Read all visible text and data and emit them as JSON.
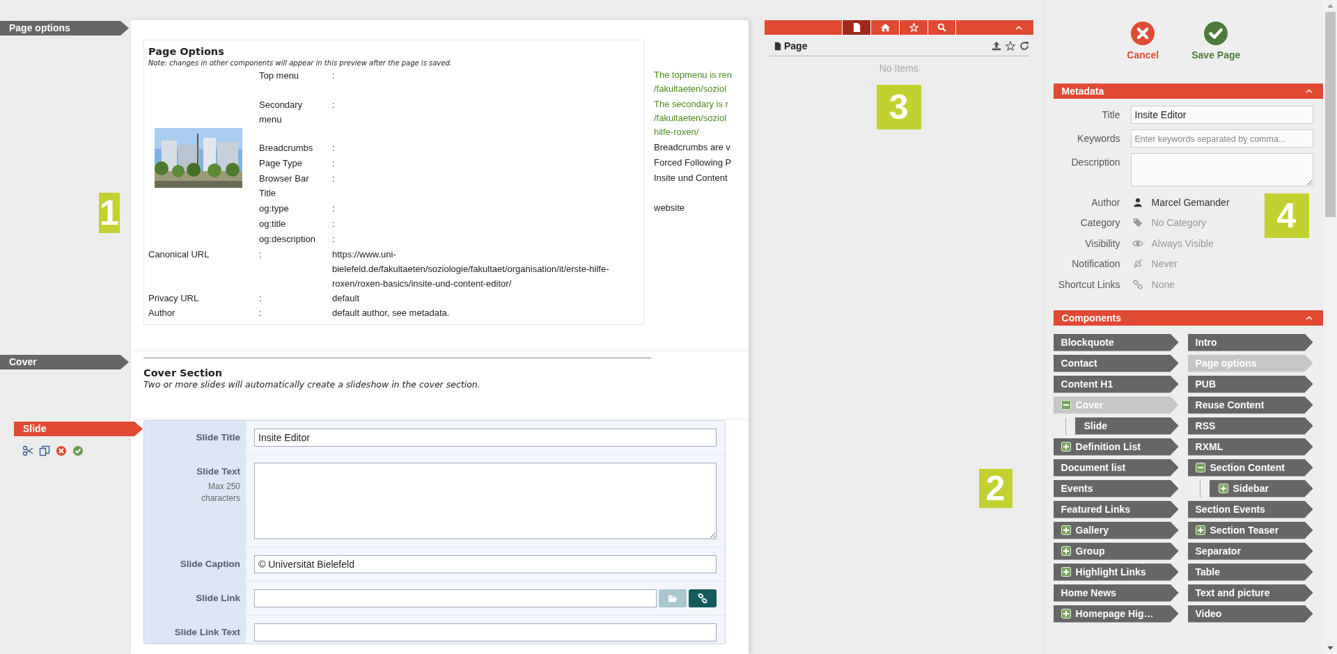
{
  "page_options": {
    "tag": "Page options",
    "callout": "1",
    "heading": "Page Options",
    "note": "Note: changes in other components will appear in this preview after the page is saved.",
    "image_rows": [
      {
        "label": "Top menu",
        "sep": ":",
        "value": [
          "The topmenu is ren",
          "/fakultaeten/soziol"
        ],
        "color": "#4a8a1c"
      },
      {
        "label": "Secondary menu",
        "sep": ":",
        "value": [
          "The secondary is r",
          "/fakultaeten/soziol",
          "hilfe-roxen/"
        ],
        "color": "#4a8a1c"
      },
      {
        "label": "Breadcrumbs",
        "sep": ":",
        "value": [
          "Breadcrumbs are v"
        ],
        "color": "#222222"
      },
      {
        "label": "Page Type",
        "sep": ":",
        "value": [
          "Forced Following P"
        ],
        "color": "#222222"
      },
      {
        "label": "Browser Bar Title",
        "sep": ":",
        "value": [
          "Insite und Content"
        ],
        "color": "#222222"
      },
      {
        "label": "og:type",
        "sep": ":",
        "value": [
          "website"
        ],
        "color": "#222222"
      },
      {
        "label": "og:title",
        "sep": ":",
        "value": []
      },
      {
        "label": "og:description",
        "sep": ":",
        "value": []
      }
    ],
    "rows": [
      {
        "label": "Canonical URL",
        "sep": ":",
        "value": "https://www.uni-bielefeld.de/fakultaeten/soziologie/fakultaet/organisation/it/erste-hilfe-roxen/roxen-basics/insite-und-content-editor/"
      },
      {
        "label": "Privacy URL",
        "sep": ":",
        "value": "default"
      },
      {
        "label": "Author",
        "sep": ":",
        "value": "default author, see metadata."
      }
    ]
  },
  "cover": {
    "tag": "Cover",
    "heading": "Cover Section",
    "note": "Two or more slides will automatically create a slideshow in the cover section."
  },
  "slide": {
    "tag": "Slide",
    "tools": [
      {
        "kind": "cut"
      },
      {
        "kind": "copy"
      },
      {
        "kind": "delete"
      },
      {
        "kind": "confirm"
      }
    ],
    "fields": [
      {
        "label": "Slide Title",
        "kind": "text",
        "value": "Insite Editor"
      },
      {
        "label": "Slide Text",
        "hint": "Max 250 characters",
        "kind": "textarea"
      },
      {
        "label": "Slide Caption",
        "kind": "text",
        "value": "© Universität Bielefeld"
      },
      {
        "label": "Slide Link",
        "kind": "link"
      },
      {
        "label": "Slide Link Text",
        "kind": "text"
      }
    ]
  },
  "browser": {
    "tabs": [
      {
        "kind": "page",
        "selected": true
      },
      {
        "kind": "home",
        "selected": false
      },
      {
        "kind": "favorites",
        "selected": false
      },
      {
        "kind": "search",
        "selected": false
      }
    ],
    "title": "Page",
    "empty": "No Items",
    "callout": "3"
  },
  "actions": [
    {
      "kind": "cancel",
      "label": "Cancel"
    },
    {
      "kind": "save",
      "label": "Save Page"
    }
  ],
  "metadata": {
    "title": "Metadata",
    "callout": "4",
    "fields": [
      {
        "label": "Title",
        "kind": "input",
        "value": "Insite Editor"
      },
      {
        "label": "Keywords",
        "kind": "input",
        "placeholder": "Enter keywords separated by comma..."
      },
      {
        "label": "Description",
        "kind": "textarea"
      }
    ],
    "info": [
      {
        "label": "Author",
        "kind": "author",
        "value": "Marcel Gemander",
        "muted": false
      },
      {
        "label": "Category",
        "kind": "category",
        "value": "No Category",
        "muted": true
      },
      {
        "label": "Visibility",
        "kind": "visibility",
        "value": "Always Visible",
        "muted": true
      },
      {
        "label": "Notification",
        "kind": "notification",
        "value": "Never",
        "muted": true
      },
      {
        "label": "Shortcut Links",
        "kind": "links",
        "value": "None",
        "muted": true
      }
    ]
  },
  "components": {
    "title": "Components",
    "callout": "2",
    "columns": [
      [
        {
          "label": "Blockquote",
          "selected": false
        },
        {
          "label": "Contact",
          "selected": false
        },
        {
          "label": "Content H1",
          "selected": false
        },
        {
          "label": "Cover",
          "selected": true,
          "expanded": true,
          "children": [
            {
              "label": "Slide",
              "selected": false
            }
          ]
        },
        {
          "label": "Definition List",
          "selected": false,
          "expanded": false
        },
        {
          "label": "Document list",
          "selected": false
        },
        {
          "label": "Events",
          "selected": false
        },
        {
          "label": "Featured Links",
          "selected": false
        },
        {
          "label": "Gallery",
          "selected": false,
          "expanded": false
        },
        {
          "label": "Group",
          "selected": false,
          "expanded": false
        },
        {
          "label": "Highlight Links",
          "selected": false,
          "expanded": false
        },
        {
          "label": "Home News",
          "selected": false
        },
        {
          "label": "Homepage Hig…",
          "selected": false,
          "expanded": false
        }
      ],
      [
        {
          "label": "Intro",
          "selected": false
        },
        {
          "label": "Page options",
          "selected": true
        },
        {
          "label": "PUB",
          "selected": false
        },
        {
          "label": "Reuse Content",
          "selected": false
        },
        {
          "label": "RSS",
          "selected": false
        },
        {
          "label": "RXML",
          "selected": false
        },
        {
          "label": "Section Content",
          "selected": false,
          "expanded": true,
          "children": [
            {
              "label": "Sidebar",
              "selected": false,
              "expanded": false
            }
          ]
        },
        {
          "label": "Section Events",
          "selected": false
        },
        {
          "label": "Section Teaser",
          "selected": false,
          "expanded": false
        },
        {
          "label": "Separator",
          "selected": false
        },
        {
          "label": "Table",
          "selected": false
        },
        {
          "label": "Text and picture",
          "selected": false
        },
        {
          "label": "Video",
          "selected": false
        }
      ]
    ]
  }
}
